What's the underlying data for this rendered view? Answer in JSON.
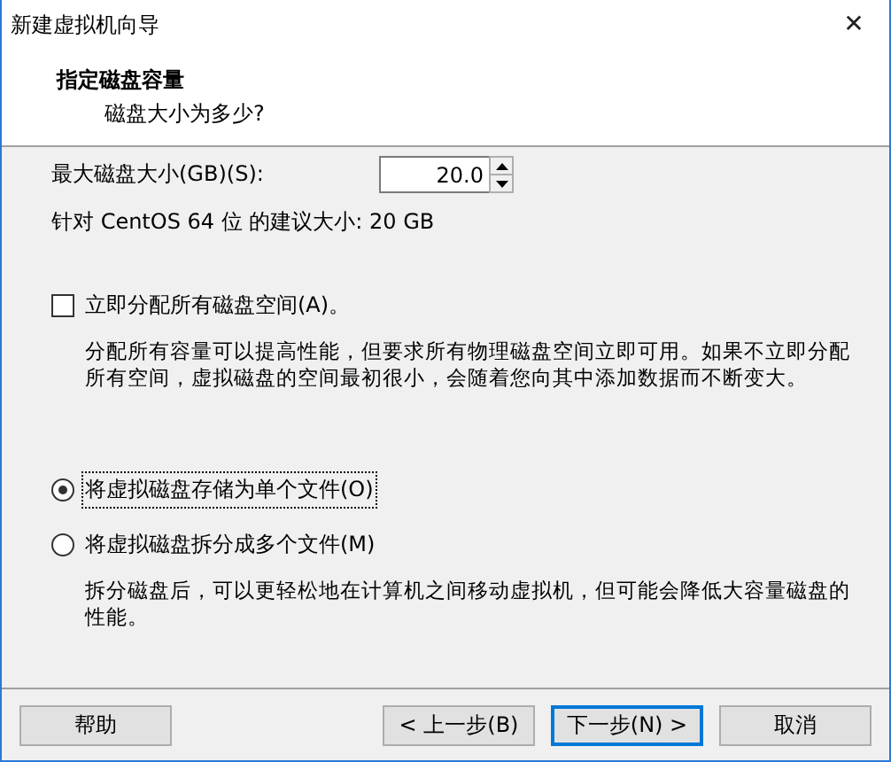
{
  "window": {
    "title": "新建虚拟机向导",
    "close": "✕"
  },
  "header": {
    "title": "指定磁盘容量",
    "subtitle": "磁盘大小为多少?"
  },
  "size_field": {
    "label": "最大磁盘大小(GB)(S):",
    "value": "20.0"
  },
  "recommendation": "针对 CentOS 64 位 的建议大小: 20 GB",
  "allocate": {
    "label": "立即分配所有磁盘空间(A)。",
    "checked": false,
    "description": "分配所有容量可以提高性能，但要求所有物理磁盘空间立即可用。如果不立即分配所有空间，虚拟磁盘的空间最初很小，会随着您向其中添加数据而不断变大。"
  },
  "storage_options": [
    {
      "label": "将虚拟磁盘存储为单个文件(O)",
      "selected": true
    },
    {
      "label": "将虚拟磁盘拆分成多个文件(M)",
      "selected": false,
      "description": "拆分磁盘后，可以更轻松地在计算机之间移动虚拟机，但可能会降低大容量磁盘的性能。"
    }
  ],
  "buttons": [
    {
      "label": "帮助",
      "kind": "help",
      "focused": false
    },
    {
      "label": "< 上一步(B)",
      "kind": "nav",
      "focused": false
    },
    {
      "label": "下一步(N) >",
      "kind": "nav",
      "focused": true
    },
    {
      "label": "取消",
      "kind": "nav",
      "focused": false
    }
  ]
}
